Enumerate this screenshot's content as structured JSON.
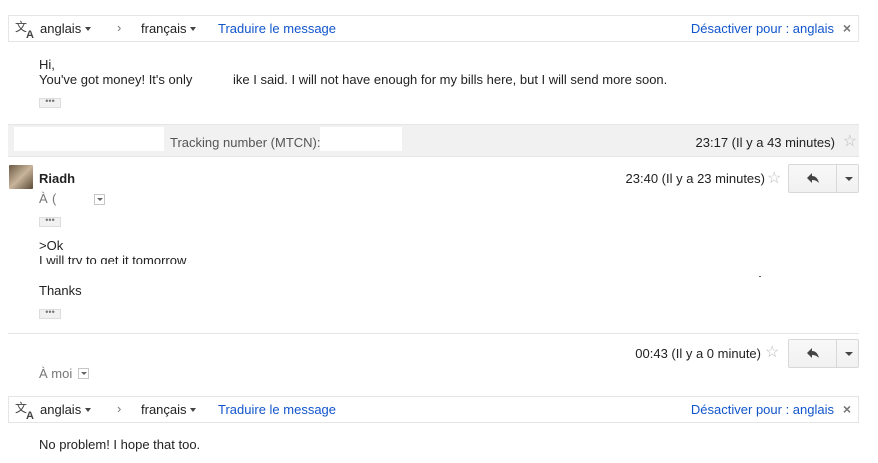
{
  "translate_bar": {
    "source_lang": "anglais",
    "target_lang": "français",
    "separator": "›",
    "translate_link": "Traduire le message",
    "disable_link": "Désactiver pour : anglais",
    "close": "×"
  },
  "message1": {
    "greeting": "Hi,",
    "body_start": "You've got money! It's only",
    "body_rest": "ike I said. I will not have enough for my bills here, but I will send more soon.",
    "ellipsis": "•••"
  },
  "collapsed": {
    "snippet": "Tracking number (MTCN):",
    "time": "23:17 (Il y a 43 minutes)"
  },
  "message2": {
    "sender": "Riadh",
    "to_prefix": "À",
    "to_fragment": "(",
    "time": "23:40 (Il y a 23 minutes)",
    "line1": ">Ok",
    "line2": "I will try to get it tomorrow",
    "line3": "Thanks",
    "ellipsis": "•••"
  },
  "message3": {
    "time": "00:43 (Il y a 0 minute)",
    "to": "À moi",
    "body": "No problem! I hope that too."
  }
}
